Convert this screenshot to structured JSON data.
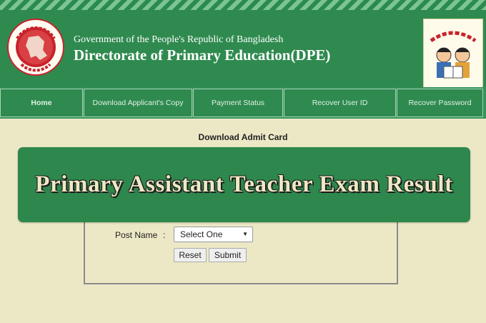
{
  "header": {
    "government_line": "Government of the People's Republic of Bangladesh",
    "title": "Directorate of Primary Education(DPE)",
    "seal_icon": "bangladesh-government-seal-icon",
    "logo_icon": "primary-education-logo-icon"
  },
  "nav": {
    "items": [
      {
        "label": "Home"
      },
      {
        "label": "Download Applicant's Copy"
      },
      {
        "label": "Payment Status"
      },
      {
        "label": "Recover User ID"
      },
      {
        "label": "Recover Password"
      }
    ]
  },
  "main": {
    "section_title": "Download Admit Card",
    "post_name_label": "Post Name",
    "separator": ":",
    "post_select_value": "Select One",
    "reset_label": "Reset",
    "submit_label": "Submit"
  },
  "banner": {
    "text": "Primary Assistant Teacher Exam Result"
  },
  "colors": {
    "header_green": "#2f8a4f",
    "page_background": "#ece8c6",
    "banner_text": "#efe8c4"
  }
}
